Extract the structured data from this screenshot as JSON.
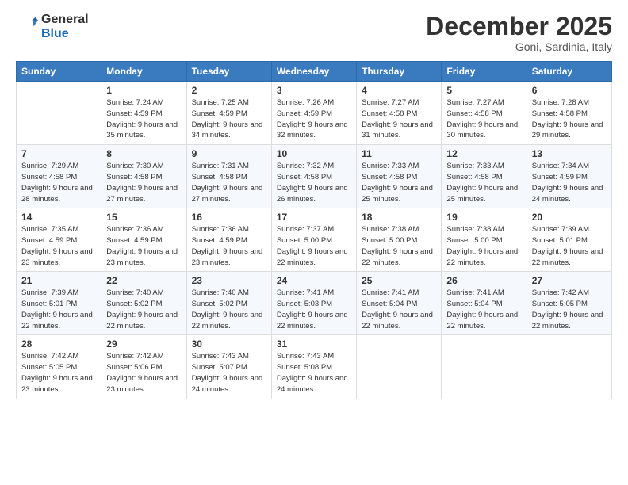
{
  "logo": {
    "general": "General",
    "blue": "Blue"
  },
  "header": {
    "title": "December 2025",
    "location": "Goni, Sardinia, Italy"
  },
  "days_of_week": [
    "Sunday",
    "Monday",
    "Tuesday",
    "Wednesday",
    "Thursday",
    "Friday",
    "Saturday"
  ],
  "weeks": [
    [
      {
        "day": "",
        "sunrise": "",
        "sunset": "",
        "daylight": ""
      },
      {
        "day": "1",
        "sunrise": "Sunrise: 7:24 AM",
        "sunset": "Sunset: 4:59 PM",
        "daylight": "Daylight: 9 hours and 35 minutes."
      },
      {
        "day": "2",
        "sunrise": "Sunrise: 7:25 AM",
        "sunset": "Sunset: 4:59 PM",
        "daylight": "Daylight: 9 hours and 34 minutes."
      },
      {
        "day": "3",
        "sunrise": "Sunrise: 7:26 AM",
        "sunset": "Sunset: 4:59 PM",
        "daylight": "Daylight: 9 hours and 32 minutes."
      },
      {
        "day": "4",
        "sunrise": "Sunrise: 7:27 AM",
        "sunset": "Sunset: 4:58 PM",
        "daylight": "Daylight: 9 hours and 31 minutes."
      },
      {
        "day": "5",
        "sunrise": "Sunrise: 7:27 AM",
        "sunset": "Sunset: 4:58 PM",
        "daylight": "Daylight: 9 hours and 30 minutes."
      },
      {
        "day": "6",
        "sunrise": "Sunrise: 7:28 AM",
        "sunset": "Sunset: 4:58 PM",
        "daylight": "Daylight: 9 hours and 29 minutes."
      }
    ],
    [
      {
        "day": "7",
        "sunrise": "Sunrise: 7:29 AM",
        "sunset": "Sunset: 4:58 PM",
        "daylight": "Daylight: 9 hours and 28 minutes."
      },
      {
        "day": "8",
        "sunrise": "Sunrise: 7:30 AM",
        "sunset": "Sunset: 4:58 PM",
        "daylight": "Daylight: 9 hours and 27 minutes."
      },
      {
        "day": "9",
        "sunrise": "Sunrise: 7:31 AM",
        "sunset": "Sunset: 4:58 PM",
        "daylight": "Daylight: 9 hours and 27 minutes."
      },
      {
        "day": "10",
        "sunrise": "Sunrise: 7:32 AM",
        "sunset": "Sunset: 4:58 PM",
        "daylight": "Daylight: 9 hours and 26 minutes."
      },
      {
        "day": "11",
        "sunrise": "Sunrise: 7:33 AM",
        "sunset": "Sunset: 4:58 PM",
        "daylight": "Daylight: 9 hours and 25 minutes."
      },
      {
        "day": "12",
        "sunrise": "Sunrise: 7:33 AM",
        "sunset": "Sunset: 4:58 PM",
        "daylight": "Daylight: 9 hours and 25 minutes."
      },
      {
        "day": "13",
        "sunrise": "Sunrise: 7:34 AM",
        "sunset": "Sunset: 4:59 PM",
        "daylight": "Daylight: 9 hours and 24 minutes."
      }
    ],
    [
      {
        "day": "14",
        "sunrise": "Sunrise: 7:35 AM",
        "sunset": "Sunset: 4:59 PM",
        "daylight": "Daylight: 9 hours and 23 minutes."
      },
      {
        "day": "15",
        "sunrise": "Sunrise: 7:36 AM",
        "sunset": "Sunset: 4:59 PM",
        "daylight": "Daylight: 9 hours and 23 minutes."
      },
      {
        "day": "16",
        "sunrise": "Sunrise: 7:36 AM",
        "sunset": "Sunset: 4:59 PM",
        "daylight": "Daylight: 9 hours and 23 minutes."
      },
      {
        "day": "17",
        "sunrise": "Sunrise: 7:37 AM",
        "sunset": "Sunset: 5:00 PM",
        "daylight": "Daylight: 9 hours and 22 minutes."
      },
      {
        "day": "18",
        "sunrise": "Sunrise: 7:38 AM",
        "sunset": "Sunset: 5:00 PM",
        "daylight": "Daylight: 9 hours and 22 minutes."
      },
      {
        "day": "19",
        "sunrise": "Sunrise: 7:38 AM",
        "sunset": "Sunset: 5:00 PM",
        "daylight": "Daylight: 9 hours and 22 minutes."
      },
      {
        "day": "20",
        "sunrise": "Sunrise: 7:39 AM",
        "sunset": "Sunset: 5:01 PM",
        "daylight": "Daylight: 9 hours and 22 minutes."
      }
    ],
    [
      {
        "day": "21",
        "sunrise": "Sunrise: 7:39 AM",
        "sunset": "Sunset: 5:01 PM",
        "daylight": "Daylight: 9 hours and 22 minutes."
      },
      {
        "day": "22",
        "sunrise": "Sunrise: 7:40 AM",
        "sunset": "Sunset: 5:02 PM",
        "daylight": "Daylight: 9 hours and 22 minutes."
      },
      {
        "day": "23",
        "sunrise": "Sunrise: 7:40 AM",
        "sunset": "Sunset: 5:02 PM",
        "daylight": "Daylight: 9 hours and 22 minutes."
      },
      {
        "day": "24",
        "sunrise": "Sunrise: 7:41 AM",
        "sunset": "Sunset: 5:03 PM",
        "daylight": "Daylight: 9 hours and 22 minutes."
      },
      {
        "day": "25",
        "sunrise": "Sunrise: 7:41 AM",
        "sunset": "Sunset: 5:04 PM",
        "daylight": "Daylight: 9 hours and 22 minutes."
      },
      {
        "day": "26",
        "sunrise": "Sunrise: 7:41 AM",
        "sunset": "Sunset: 5:04 PM",
        "daylight": "Daylight: 9 hours and 22 minutes."
      },
      {
        "day": "27",
        "sunrise": "Sunrise: 7:42 AM",
        "sunset": "Sunset: 5:05 PM",
        "daylight": "Daylight: 9 hours and 22 minutes."
      }
    ],
    [
      {
        "day": "28",
        "sunrise": "Sunrise: 7:42 AM",
        "sunset": "Sunset: 5:05 PM",
        "daylight": "Daylight: 9 hours and 23 minutes."
      },
      {
        "day": "29",
        "sunrise": "Sunrise: 7:42 AM",
        "sunset": "Sunset: 5:06 PM",
        "daylight": "Daylight: 9 hours and 23 minutes."
      },
      {
        "day": "30",
        "sunrise": "Sunrise: 7:43 AM",
        "sunset": "Sunset: 5:07 PM",
        "daylight": "Daylight: 9 hours and 24 minutes."
      },
      {
        "day": "31",
        "sunrise": "Sunrise: 7:43 AM",
        "sunset": "Sunset: 5:08 PM",
        "daylight": "Daylight: 9 hours and 24 minutes."
      },
      {
        "day": "",
        "sunrise": "",
        "sunset": "",
        "daylight": ""
      },
      {
        "day": "",
        "sunrise": "",
        "sunset": "",
        "daylight": ""
      },
      {
        "day": "",
        "sunrise": "",
        "sunset": "",
        "daylight": ""
      }
    ]
  ]
}
